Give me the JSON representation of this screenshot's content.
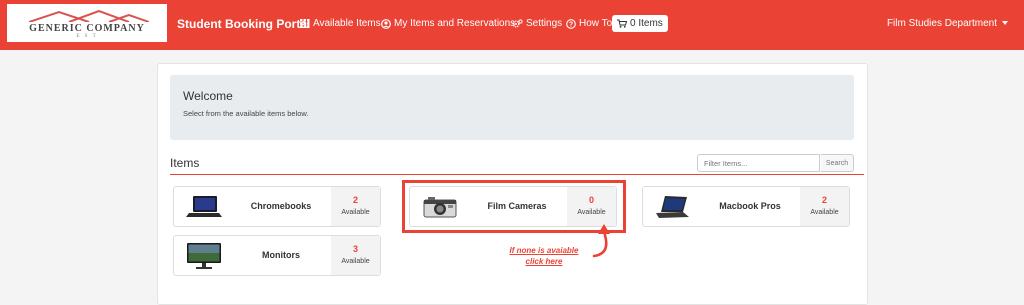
{
  "logo": {
    "company": "GENERIC COMPANY",
    "sub": "E S T"
  },
  "nav": {
    "brand": "Student Booking Portal",
    "links": [
      "Available Items",
      "My Items and Reservations",
      "Settings",
      "How To"
    ],
    "cart": "0 Items",
    "department": "Film Studies Department"
  },
  "welcome": {
    "title": "Welcome",
    "subtitle": "Select from the available items below."
  },
  "items": {
    "title": "Items",
    "filter_placeholder": "Filter Items...",
    "search_label": "Search"
  },
  "cards": [
    {
      "name": "Chromebooks",
      "count": "2",
      "label": "Available"
    },
    {
      "name": "Film Cameras",
      "count": "0",
      "label": "Available"
    },
    {
      "name": "Macbook Pros",
      "count": "2",
      "label": "Available"
    },
    {
      "name": "Monitors",
      "count": "3",
      "label": "Available"
    }
  ],
  "annotation": {
    "line1": "If none is avaiable",
    "line2": "click here"
  },
  "colors": {
    "accent": "#ea4335",
    "panel_bg": "#e9ecef"
  }
}
